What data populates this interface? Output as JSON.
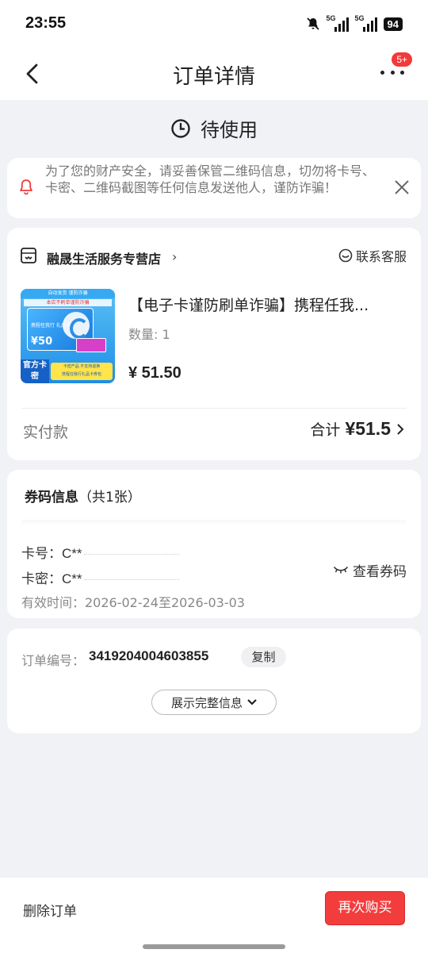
{
  "status_bar": {
    "time": "23:55",
    "network_1": "5G",
    "network_2": "5G",
    "battery": "94"
  },
  "nav": {
    "title": "订单详情",
    "badge": "5+"
  },
  "order_status": {
    "text": "待使用"
  },
  "warning": {
    "text": "为了您的财产安全，请妥善保管二维码信息，切勿将卡号、卡密、二维码截图等任何信息发送他人，谨防诈骗！"
  },
  "shop": {
    "name": "融晟生活服务专营店",
    "chevron": "›",
    "service_label": "联系客服"
  },
  "product": {
    "title": "【电子卡谨防刷单诈骗】携程任我...",
    "quantity": "数量: 1",
    "price": "¥ 51.50",
    "image": {
      "top_strip": "自动发货  谨防诈骗",
      "shop_line": "本店不刷单谨防诈骗",
      "card_title": "携程任我行 礼品卡",
      "card_amount": "¥50",
      "official": "官方卡密",
      "yellow_1": "卡密产品  不支持退换",
      "yellow_2": "携程任我行礼品卡券包"
    }
  },
  "payment": {
    "label": "实付款",
    "total_label": "合计",
    "total_value": "¥51.5",
    "chevron": "›"
  },
  "voucher": {
    "title": "券码信息",
    "count": "（共1张）",
    "card_no_label": "卡号：",
    "card_no_value": "C**",
    "card_pwd_label": "卡密：",
    "card_pwd_value": "C**",
    "view_label": "查看券码",
    "valid": "有效时间：2026-02-24至2026-03-03"
  },
  "order": {
    "no_label": "订单编号：",
    "no_value": "3419204004603855",
    "copy_label": "复制",
    "expand_label": "展示完整信息"
  },
  "bottom": {
    "delete_label": "删除订单",
    "buy_again_label": "再次购买"
  },
  "colors": {
    "accent": "#f33d3d",
    "background": "#f1f2f6"
  }
}
